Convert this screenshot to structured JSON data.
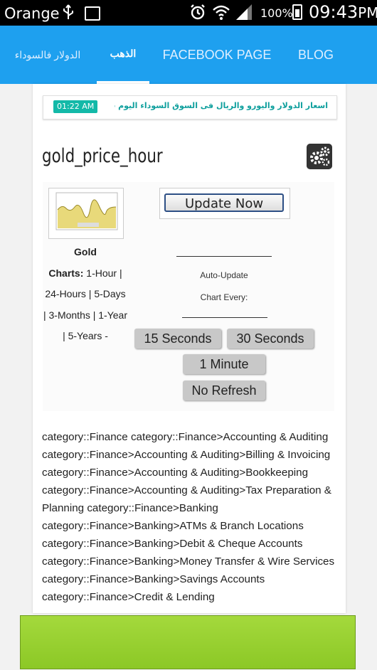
{
  "status_bar": {
    "carrier": "Orange",
    "battery_percent": "100%",
    "time": "09:43",
    "time_suffix": "PM"
  },
  "nav": {
    "tabs": [
      {
        "label": "الدولار فالسوداء"
      },
      {
        "label": "الذهب"
      },
      {
        "label": "FACEBOOK PAGE"
      },
      {
        "label": "BLOG"
      }
    ]
  },
  "ticker": {
    "time": "01:22 AM",
    "text": "اسعار الدولار واليورو والريال فى السوق السوداء اليوم فى"
  },
  "widget": {
    "title": "gold_price_hour",
    "chart_title": "Gold",
    "chart_links_label": "Charts:",
    "chart_links": "1-Hour | 24-Hours | 5-Days | 3-Months | 1-Year | 5-Years -",
    "update_button": "Update Now",
    "auto_update_label": "Auto-Update",
    "chart_every_label": "Chart Every:",
    "interval_buttons": [
      "15 Seconds",
      "30 Seconds",
      "1 Minute",
      "No Refresh"
    ]
  },
  "categories_text": "category::Finance category::Finance>Accounting & Auditing category::Finance>Accounting & Auditing>Billing & Invoicing category::Finance>Accounting & Auditing>Bookkeeping category::Finance>Accounting & Auditing>Tax Preparation & Planning category::Finance>Banking category::Finance>Banking>ATMs & Branch Locations category::Finance>Banking>Debit & Cheque Accounts category::Finance>Banking>Money Transfer & Wire Services category::Finance>Banking>Savings Accounts category::Finance>Credit & Lending",
  "colors": {
    "nav_blue": "#1ea0ef",
    "ticker_teal": "#13b9a8",
    "banner_green": "#9bd033"
  }
}
